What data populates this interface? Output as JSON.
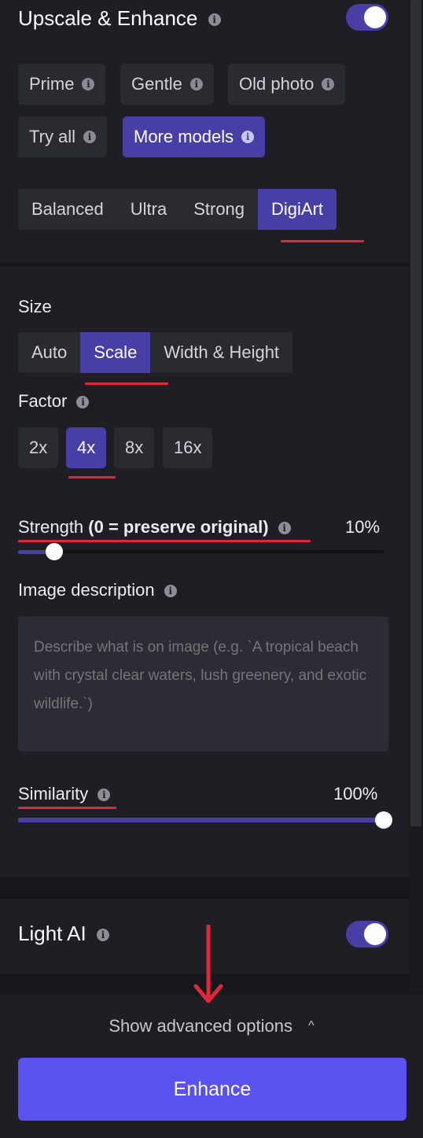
{
  "upscale": {
    "title": "Upscale & Enhance",
    "toggle_on": true,
    "models": [
      {
        "label": "Prime",
        "active": false
      },
      {
        "label": "Gentle",
        "active": false
      },
      {
        "label": "Old photo",
        "active": false
      },
      {
        "label": "Try all",
        "active": false
      },
      {
        "label": "More models",
        "active": true
      }
    ],
    "modes": [
      {
        "label": "Balanced",
        "active": false
      },
      {
        "label": "Ultra",
        "active": false
      },
      {
        "label": "Strong",
        "active": false
      },
      {
        "label": "DigiArt",
        "active": true
      }
    ]
  },
  "size": {
    "label": "Size",
    "options": [
      {
        "label": "Auto",
        "active": false
      },
      {
        "label": "Scale",
        "active": true
      },
      {
        "label": "Width & Height",
        "active": false
      }
    ],
    "factor_label": "Factor",
    "factors": [
      {
        "label": "2x",
        "active": false
      },
      {
        "label": "4x",
        "active": true
      },
      {
        "label": "8x",
        "active": false
      },
      {
        "label": "16x",
        "active": false
      }
    ]
  },
  "strength": {
    "label": "Strength",
    "hint": "(0 = preserve original)",
    "value_text": "10%",
    "value": 0.1
  },
  "description": {
    "label": "Image description",
    "placeholder": "Describe what is on image (e.g. `A tropical beach with crystal clear waters, lush greenery, and exotic wildlife.`)"
  },
  "similarity": {
    "label": "Similarity",
    "value_text": "100%",
    "value": 1.0
  },
  "light_ai": {
    "label": "Light AI",
    "toggle_on": true
  },
  "footer": {
    "advanced_label": "Show advanced options",
    "chevron": "^",
    "enhance_label": "Enhance"
  },
  "colors": {
    "accent": "#473fa6",
    "button": "#5a52ef",
    "annotation": "#e0283a"
  }
}
